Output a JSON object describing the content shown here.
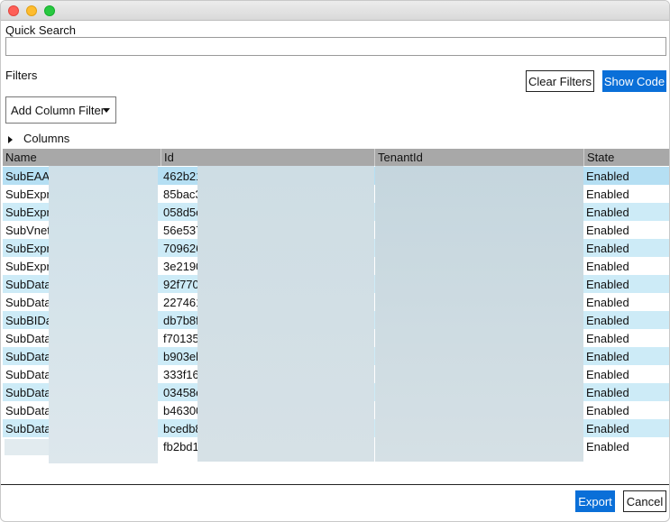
{
  "search": {
    "label": "Quick Search",
    "value": "",
    "placeholder": ""
  },
  "filters": {
    "label": "Filters",
    "clear_label": "Clear Filters",
    "show_code_label": "Show Code",
    "add_filter_label": "Add Column Filter"
  },
  "columns_toggle": {
    "label": "Columns"
  },
  "table": {
    "headers": [
      "Name",
      "Id",
      "TenantId",
      "State"
    ],
    "rows": [
      {
        "name": "SubEAAr",
        "id": "462b21",
        "state": "Enabled"
      },
      {
        "name": "SubExpre",
        "id": "85bac3",
        "state": "Enabled"
      },
      {
        "name": "SubExpre",
        "id": "058d5c",
        "state": "Enabled"
      },
      {
        "name": "SubVneta",
        "id": "56e537",
        "state": "Enabled"
      },
      {
        "name": "SubExpre",
        "id": "709626",
        "state": "Enabled"
      },
      {
        "name": "SubExpre",
        "id": "3e2190",
        "state": "Enabled"
      },
      {
        "name": "SubData",
        "id": "92f770",
        "state": "Enabled"
      },
      {
        "name": "SubData",
        "id": "227461",
        "state": "Enabled"
      },
      {
        "name": "SubBIDa",
        "id": "db7b8f",
        "state": "Enabled"
      },
      {
        "name": "SubData",
        "id": "f70135",
        "state": "Enabled"
      },
      {
        "name": "SubData",
        "id": "b903eb",
        "state": "Enabled"
      },
      {
        "name": "SubData",
        "id": "333f16",
        "state": "Enabled"
      },
      {
        "name": "SubData",
        "id": "03458e",
        "state": "Enabled"
      },
      {
        "name": "SubData",
        "id": "b46300",
        "state": "Enabled"
      },
      {
        "name": "SubData",
        "id": "bcedb8",
        "state": "Enabled"
      },
      {
        "name": "",
        "id": "fb2bd1",
        "state": "Enabled"
      }
    ]
  },
  "footer": {
    "export_label": "Export",
    "cancel_label": "Cancel"
  },
  "colors": {
    "primary": "#0a6fd8",
    "row_alt": "#cdebf7",
    "row_selected": "#b5dff3",
    "header": "#a8a8a8"
  }
}
